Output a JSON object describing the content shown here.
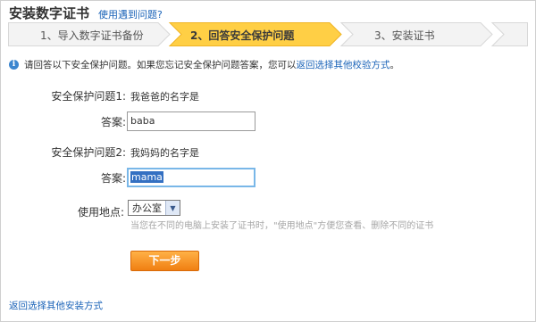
{
  "header": {
    "title": "安装数字证书",
    "help_link": "使用遇到问题?"
  },
  "steps": [
    {
      "label": "1、导入数字证书备份",
      "active": false
    },
    {
      "label": "2、回答安全保护问题",
      "active": true
    },
    {
      "label": "3、安装证书",
      "active": false
    }
  ],
  "info": {
    "text": "请回答以下安全保护问题。如果您忘记安全保护问题答案，您可以",
    "link": "返回选择其他校验方式",
    "suffix": "。"
  },
  "form": {
    "q1_label": "安全保护问题1:",
    "q1_text": "我爸爸的名字是",
    "a1_label": "答案:",
    "a1_value": "baba",
    "q2_label": "安全保护问题2:",
    "q2_text": "我妈妈的名字是",
    "a2_label": "答案:",
    "a2_value": "mama",
    "location_label": "使用地点:",
    "location_value": "办公室",
    "location_hint": "当您在不同的电脑上安装了证书时，\"使用地点\"方便您查看、删除不同的证书"
  },
  "buttons": {
    "next": "下一步"
  },
  "footer": {
    "link": "返回选择其他安装方式"
  },
  "colors": {
    "active_step": "#ffcf45",
    "link": "#1a63b8",
    "button": "#f28a18"
  }
}
